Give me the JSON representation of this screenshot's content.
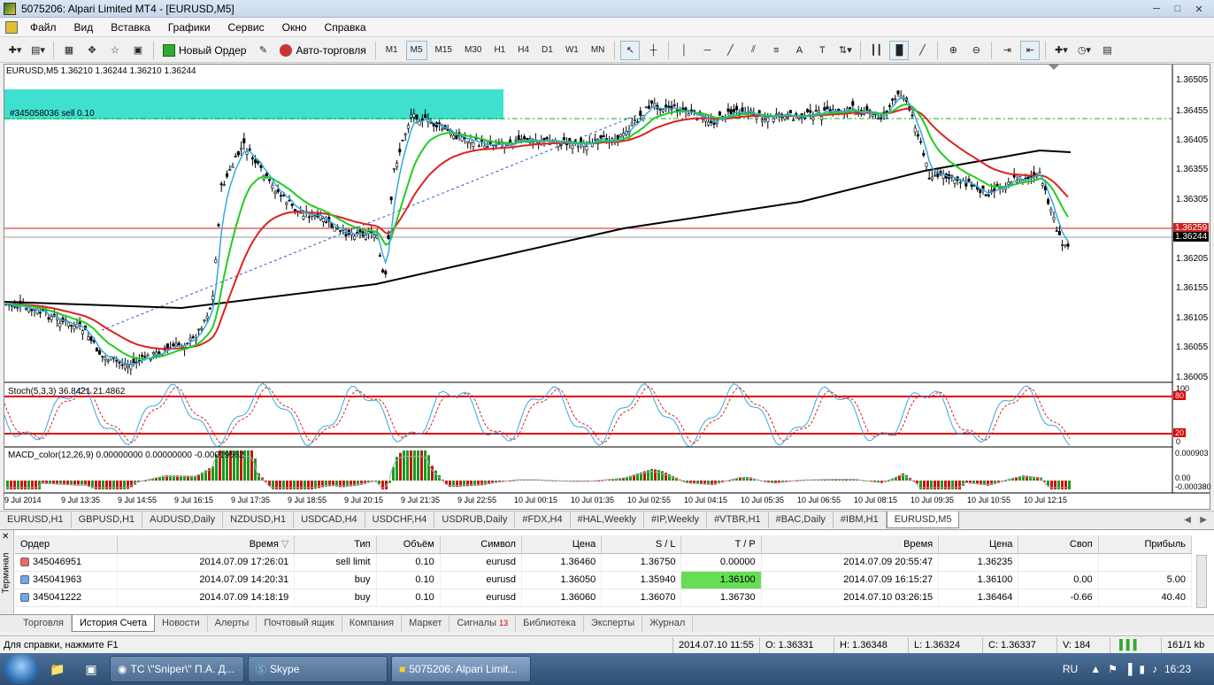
{
  "window": {
    "title": "5075206: Alpari Limited MT4 - [EURUSD,M5]"
  },
  "menu": [
    "Файл",
    "Вид",
    "Вставка",
    "Графики",
    "Сервис",
    "Окно",
    "Справка"
  ],
  "toolbar": {
    "new_order": "Новый Ордер",
    "autotrading": "Авто-торговля",
    "timeframes": [
      "M1",
      "M5",
      "M15",
      "M30",
      "H1",
      "H4",
      "D1",
      "W1",
      "MN"
    ],
    "active_timeframe": "M5"
  },
  "chart": {
    "header": "EURUSD,M5  1.36210 1.36244 1.36210 1.36244",
    "order_label": "#345058036 sell 0.10",
    "price_labels": [
      "1.36505",
      "1.36455",
      "1.36405",
      "1.36355",
      "1.36305",
      "1.36259",
      "1.36244",
      "1.36205",
      "1.36155",
      "1.36105",
      "1.36055",
      "1.36005"
    ],
    "current_price": "1.36244",
    "line_price": "1.36259",
    "time_labels": [
      "9 Jul 2014",
      "9 Jul 13:35",
      "9 Jul 14:55",
      "9 Jul 16:15",
      "9 Jul 17:35",
      "9 Jul 18:55",
      "9 Jul 20:15",
      "9 Jul 21:35",
      "9 Jul 22:55",
      "10 Jul 00:15",
      "10 Jul 01:35",
      "10 Jul 02:55",
      "10 Jul 04:15",
      "10 Jul 05:35",
      "10 Jul 06:55",
      "10 Jul 08:15",
      "10 Jul 09:35",
      "10 Jul 10:55",
      "10 Jul 12:15"
    ],
    "stoch_label": "Stoch(5,3,3) 36.8421 21.4862",
    "stoch_levels": [
      "100",
      "80",
      "20",
      "0"
    ],
    "macd_label": "MACD_color(12,26,9) 0.00000000 0.00000000 -0.00019562",
    "macd_levels": [
      "0.000903",
      "0.00",
      "-0.000380"
    ],
    "colors": {
      "ma_fast": "#33aadd",
      "ma_mid": "#22cc22",
      "ma_slow": "#dd2222",
      "ma_long": "#000000",
      "order_zone": "#40e0d0"
    }
  },
  "chart_tabs": [
    "EURUSD,H1",
    "GBPUSD,H1",
    "AUDUSD,Daily",
    "NZDUSD,H1",
    "USDCAD,H4",
    "USDCHF,H4",
    "USDRUB,Daily",
    "#FDX,H4",
    "#HAL,Weekly",
    "#IP,Weekly",
    "#VTBR,H1",
    "#BAC,Daily",
    "#IBM,H1",
    "EURUSD,M5"
  ],
  "active_chart_tab": "EURUSD,M5",
  "terminal": {
    "side_label": "Терминал",
    "columns": [
      "Ордер",
      "Время",
      "Тип",
      "Объём",
      "Символ",
      "Цена",
      "S / L",
      "T / P",
      "Время",
      "Цена",
      "Своп",
      "Прибыль"
    ],
    "rows": [
      [
        "345046951",
        "2014.07.09 17:26:01",
        "sell limit",
        "0.10",
        "eurusd",
        "1.36460",
        "1.36750",
        "0.00000",
        "2014.07.09 20:55:47",
        "1.36235",
        "",
        ""
      ],
      [
        "345041963",
        "2014.07.09 14:20:31",
        "buy",
        "0.10",
        "eurusd",
        "1.36050",
        "1.35940",
        "1.36100",
        "2014.07.09 16:15:27",
        "1.36100",
        "0.00",
        "5.00"
      ],
      [
        "345041222",
        "2014.07.09 14:18:19",
        "buy",
        "0.10",
        "eurusd",
        "1.36060",
        "1.36070",
        "1.36730",
        "2014.07.10 03:26:15",
        "1.36464",
        "-0.66",
        "40.40"
      ]
    ],
    "tabs": [
      "Торговля",
      "История Счета",
      "Новости",
      "Алерты",
      "Почтовый ящик",
      "Компания",
      "Маркет",
      "Сигналы",
      "Библиотека",
      "Эксперты",
      "Журнал"
    ],
    "active_tab": "История Счета",
    "signals_badge": "13"
  },
  "status": {
    "help": "Для справки, нажмите F1",
    "datetime": "2014.07.10 11:55",
    "open": "O: 1.36331",
    "high": "H: 1.36348",
    "low": "L: 1.36324",
    "close": "C: 1.36337",
    "volume": "V: 184",
    "traffic": "161/1 kb"
  },
  "taskbar": {
    "items": [
      "ТС \\\"Sniper\\\" П.А. Д...",
      "Skype",
      "5075206: Alpari Limit..."
    ],
    "lang": "RU",
    "clock": "16:23"
  }
}
